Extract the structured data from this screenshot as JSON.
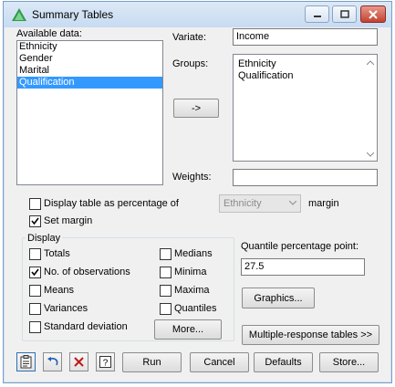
{
  "window": {
    "title": "Summary Tables"
  },
  "available_data": {
    "label": "Available data:",
    "items": [
      "Ethnicity",
      "Gender",
      "Marital",
      "Qualification"
    ],
    "selected_index": 3
  },
  "variate": {
    "label": "Variate:",
    "value": "Income"
  },
  "groups": {
    "label": "Groups:",
    "items": [
      "Ethnicity",
      "Qualification"
    ]
  },
  "move_button": {
    "label": "->"
  },
  "weights": {
    "label": "Weights:",
    "value": ""
  },
  "percentage": {
    "label": "Display table as percentage of",
    "checked": false,
    "combo_value": "Ethnicity",
    "suffix": "margin"
  },
  "set_margin": {
    "label": "Set margin",
    "checked": true
  },
  "display": {
    "group_label": "Display",
    "left": [
      {
        "label": "Totals",
        "checked": false
      },
      {
        "label": "No. of observations",
        "checked": true
      },
      {
        "label": "Means",
        "checked": false
      },
      {
        "label": "Variances",
        "checked": false
      },
      {
        "label": "Standard deviation",
        "checked": false
      }
    ],
    "right": [
      {
        "label": "Medians",
        "checked": false
      },
      {
        "label": "Minima",
        "checked": false
      },
      {
        "label": "Maxima",
        "checked": false
      },
      {
        "label": "Quantiles",
        "checked": false
      }
    ],
    "more_label": "More..."
  },
  "quantile": {
    "label": "Quantile percentage point:",
    "value": "27.5"
  },
  "graphics_button": {
    "label": "Graphics..."
  },
  "multiple_response_button": {
    "label": "Multiple-response tables >>"
  },
  "footer": {
    "run": "Run",
    "cancel": "Cancel",
    "defaults": "Defaults",
    "store": "Store..."
  }
}
